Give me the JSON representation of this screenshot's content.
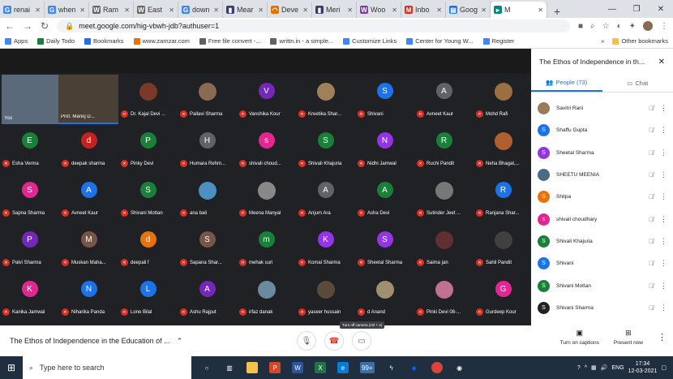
{
  "browser": {
    "tabs": [
      {
        "label": "renai",
        "icon": "G",
        "color": "#4285f4"
      },
      {
        "label": "when",
        "icon": "G",
        "color": "#4285f4"
      },
      {
        "label": "Ram",
        "icon": "W",
        "color": "#666"
      },
      {
        "label": "East",
        "icon": "W",
        "color": "#666"
      },
      {
        "label": "down",
        "icon": "G",
        "color": "#4285f4"
      },
      {
        "label": "Mear",
        "icon": "▮",
        "color": "#3b3b6d"
      },
      {
        "label": "Deve",
        "icon": "◠",
        "color": "#e37400"
      },
      {
        "label": "Meri",
        "icon": "▮",
        "color": "#3b3b6d"
      },
      {
        "label": "Woo",
        "icon": "W",
        "color": "#7b3fa0"
      },
      {
        "label": "Inbo",
        "icon": "M",
        "color": "#d93025"
      },
      {
        "label": "Goog",
        "icon": "▤",
        "color": "#1a73e8"
      },
      {
        "label": "M",
        "icon": "▸",
        "color": "#00897b"
      }
    ],
    "url": "meet.google.com/hig-vbwh-jdb?authuser=1",
    "bookmarks": [
      "Apps",
      "Daily Todo",
      "Bookmarks",
      "www.zamzar.com",
      "Free file convert -...",
      "writtn.in - a simple...",
      "Customize Links",
      "Center for Young W...",
      "Register"
    ],
    "other_bookmarks": "Other bookmarks"
  },
  "grid": {
    "video_tiles": [
      "You",
      "Prof. Manoj D..."
    ],
    "row0": [
      {
        "n": "Dr. Kajal Devi ...",
        "i": "",
        "c": "#7a3a2a"
      },
      {
        "n": "Pallavi Sharma",
        "i": "",
        "c": "#8a6a50"
      },
      {
        "n": "Vanshika Kour",
        "i": "V",
        "c": "#7627bb"
      },
      {
        "n": "Kreetika Shar...",
        "i": "",
        "c": "#a0805a"
      },
      {
        "n": "Shivani",
        "i": "S",
        "c": "#1a73e8"
      },
      {
        "n": "Avneet Kaur",
        "i": "A",
        "c": "#5f6368"
      },
      {
        "n": "Mohd Rafi",
        "i": "",
        "c": "#9a7040"
      }
    ],
    "row1": [
      {
        "n": "Esha Verma",
        "i": "E",
        "c": "#188038"
      },
      {
        "n": "deepak sharma",
        "i": "d",
        "c": "#c5221f"
      },
      {
        "n": "Pinky Devi",
        "i": "P",
        "c": "#188038"
      },
      {
        "n": "Humara Rehm...",
        "i": "H",
        "c": "#5f6368"
      },
      {
        "n": "shivali choud...",
        "i": "s",
        "c": "#e52592"
      },
      {
        "n": "Shivali Khajuria",
        "i": "S",
        "c": "#188038"
      },
      {
        "n": "Nidhi Jamwal",
        "i": "N",
        "c": "#9334e6"
      },
      {
        "n": "Ruchi Pandit",
        "i": "R",
        "c": "#188038"
      },
      {
        "n": "Neha Bhagat,...",
        "i": "",
        "c": "#b06030"
      }
    ],
    "row2": [
      {
        "n": "Sapna Sharma",
        "i": "S",
        "c": "#e52592"
      },
      {
        "n": "Avneet Kaur",
        "i": "A",
        "c": "#1a73e8"
      },
      {
        "n": "Shivani Mottan",
        "i": "S",
        "c": "#188038"
      },
      {
        "n": "ana bali",
        "i": "",
        "c": "#4a90c0"
      },
      {
        "n": "Meena Manyal",
        "i": "",
        "c": "#888"
      },
      {
        "n": "Anjum Ara",
        "i": "A",
        "c": "#5f6368"
      },
      {
        "n": "Asha Devi",
        "i": "A",
        "c": "#188038"
      },
      {
        "n": "Sutinder Jeet ...",
        "i": "",
        "c": "#777"
      },
      {
        "n": "Ranjana Shar...",
        "i": "R",
        "c": "#1a73e8"
      }
    ],
    "row3": [
      {
        "n": "Palvi Sharma",
        "i": "P",
        "c": "#7627bb"
      },
      {
        "n": "Muskan Maha...",
        "i": "M",
        "c": "#795548"
      },
      {
        "n": "deepali f",
        "i": "d",
        "c": "#e8710a"
      },
      {
        "n": "Sapana Shar...",
        "i": "S",
        "c": "#795548"
      },
      {
        "n": "mehak suri",
        "i": "m",
        "c": "#188038"
      },
      {
        "n": "Komal Sharma",
        "i": "K",
        "c": "#9334e6"
      },
      {
        "n": "Sheetal Sharma",
        "i": "S",
        "c": "#9334e6"
      },
      {
        "n": "Saima jan",
        "i": "",
        "c": "#603030"
      },
      {
        "n": "Sahil Pandit",
        "i": "",
        "c": "#404040"
      }
    ],
    "row4": [
      {
        "n": "Kanika Jamwal",
        "i": "K",
        "c": "#e52592"
      },
      {
        "n": "Niharika Panda",
        "i": "N",
        "c": "#1a73e8"
      },
      {
        "n": "Lone Bilal",
        "i": "L",
        "c": "#1a73e8"
      },
      {
        "n": "Ashu Rajput",
        "i": "A",
        "c": "#7627bb"
      },
      {
        "n": "irfaz danak",
        "i": "",
        "c": "#6a8aa0"
      },
      {
        "n": "yaseer hussain",
        "i": "",
        "c": "#5a4a3a"
      },
      {
        "n": "d Anand",
        "i": "",
        "c": "#a09070"
      },
      {
        "n": "Pinki Devi 08-...",
        "i": "",
        "c": "#c07090"
      },
      {
        "n": "Gurdeep Kour",
        "i": "G",
        "c": "#e52592"
      }
    ]
  },
  "side": {
    "title": "The Ethos of Independence in th...",
    "people_tab": "People (73)",
    "chat_tab": "Chat",
    "people": [
      {
        "n": "Savitri Rani",
        "i": "",
        "c": "#9a7a5a"
      },
      {
        "n": "Shaffu Gupta",
        "i": "S",
        "c": "#1a73e8"
      },
      {
        "n": "Sheetal Sharma",
        "i": "S",
        "c": "#9334e6"
      },
      {
        "n": "SHEETU MEENIA",
        "i": "",
        "c": "#4a6a8a"
      },
      {
        "n": "Shilpa",
        "i": "S",
        "c": "#e8710a"
      },
      {
        "n": "shivali choudhary",
        "i": "s",
        "c": "#e52592"
      },
      {
        "n": "Shivali Khajuria",
        "i": "S",
        "c": "#188038"
      },
      {
        "n": "Shivani",
        "i": "S",
        "c": "#1a73e8"
      },
      {
        "n": "Shivani Mottan",
        "i": "S",
        "c": "#188038"
      },
      {
        "n": "Shivani Sharma",
        "i": "S",
        "c": "#202124"
      }
    ]
  },
  "bottom": {
    "meeting_title": "The Ethos of Independence in the Education of ...",
    "tooltip": "Turn off camera (ctrl + e)",
    "captions": "Turn on captions",
    "present": "Present now"
  },
  "taskbar": {
    "search_placeholder": "Type here to search",
    "lang": "ENG",
    "time": "17:34",
    "date": "12-03-2021",
    "badge": "99+"
  }
}
